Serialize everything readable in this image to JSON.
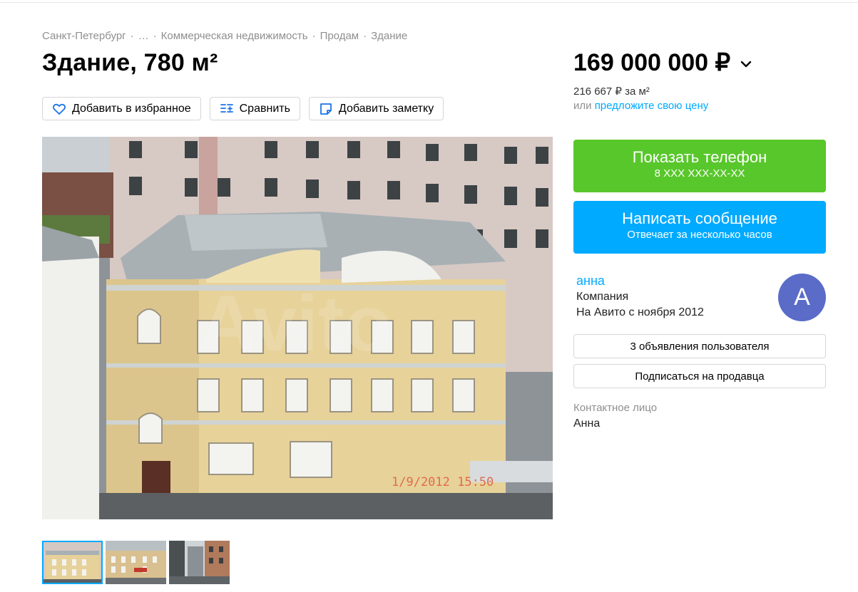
{
  "breadcrumb": {
    "items": [
      "Санкт-Петербург",
      "…",
      "Коммерческая недвижимость",
      "Продам",
      "Здание"
    ],
    "separator": "·"
  },
  "title": "Здание, 780 м²",
  "actions": {
    "favorite": "Добавить в избранное",
    "compare": "Сравнить",
    "note": "Добавить заметку"
  },
  "photo": {
    "timestamp_overlay": "1/9/2012 15:50",
    "watermark": "Avito"
  },
  "thumbnails": {
    "count": 3,
    "active_index": 0
  },
  "price": {
    "value": "169 000 000 ₽",
    "per_sqm": "216 667 ₽ за м²",
    "offer_prefix": "или",
    "offer_link": "предложите свою цену"
  },
  "cta": {
    "show_phone": "Показать телефон",
    "phone_masked": "8 XXX XXX-XX-XX",
    "write_message": "Написать сообщение",
    "reply_time": "Отвечает за несколько часов"
  },
  "seller": {
    "name": "анна",
    "type": "Компания",
    "since": "На Авито с ноября 2012",
    "avatar_letter": "А",
    "listings_button": "3 объявления пользователя",
    "subscribe_button": "Подписаться на продавца"
  },
  "contact": {
    "label": "Контактное лицо",
    "name": "Анна"
  },
  "colors": {
    "accent_blue": "#00aaff",
    "green": "#58c72b",
    "avatar": "#5a6cc8"
  },
  "icons": {
    "favorite": "heart-icon",
    "compare": "compare-icon",
    "note": "note-icon",
    "price_toggle": "chevron-down-icon"
  }
}
